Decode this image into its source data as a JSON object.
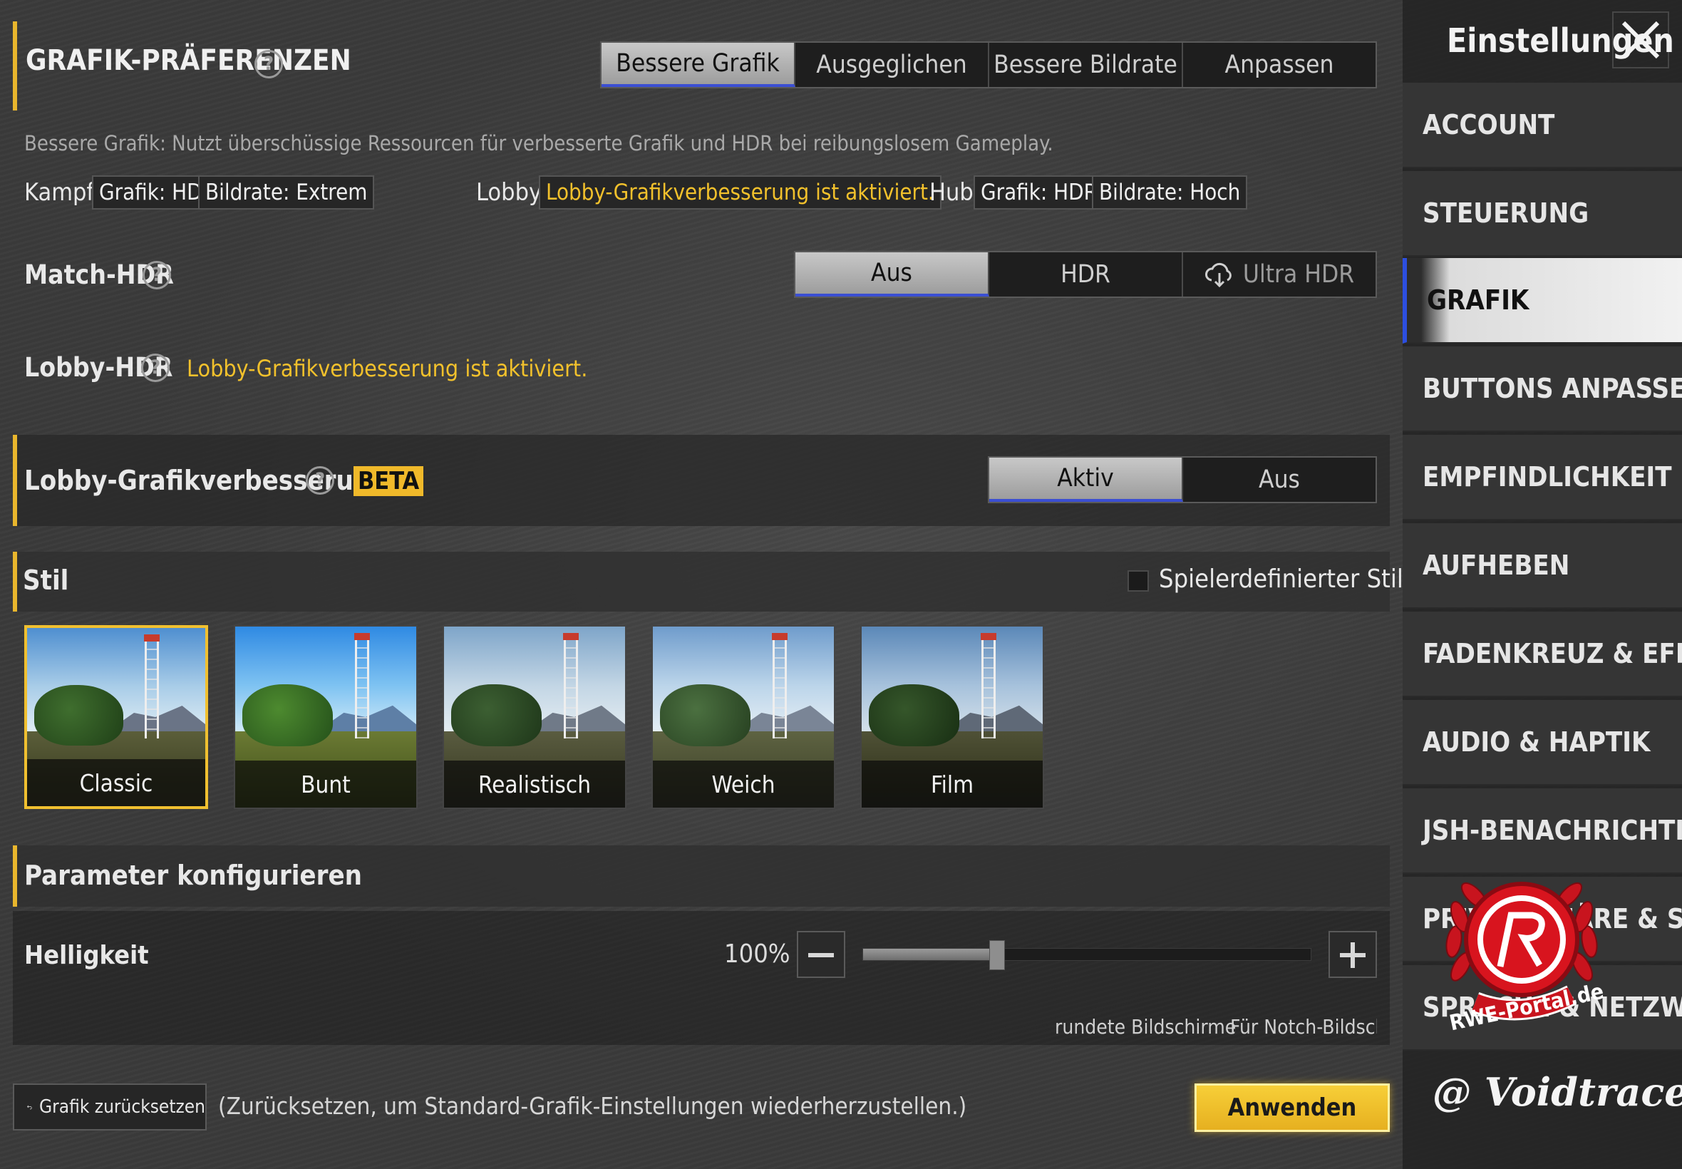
{
  "window": {
    "title": "Einstellungen"
  },
  "prefs": {
    "title": "GRAFIK-PRÄFERENZEN",
    "tabs": [
      "Bessere Grafik",
      "Ausgeglichen",
      "Bessere Bildrate",
      "Anpassen"
    ],
    "selected_tab": "Bessere Grafik",
    "description": "Bessere Grafik: Nutzt überschüssige Ressourcen für verbesserte Grafik und HDR bei reibungslosem Gameplay.",
    "kampf": {
      "label": "Kampf",
      "grafik": "Grafik: HD",
      "bildrate": "Bildrate: Extrem"
    },
    "lobby": {
      "label": "Lobby",
      "value": "Lobby-Grafikverbesserung ist aktiviert."
    },
    "hub": {
      "label": "Hub",
      "grafik": "Grafik: HDR",
      "bildrate": "Bildrate: Hoch"
    }
  },
  "match_hdr": {
    "label": "Match-HDR",
    "options": [
      "Aus",
      "HDR",
      "Ultra HDR"
    ],
    "selected": "Aus"
  },
  "lobby_hdr": {
    "label": "Lobby-HDR",
    "status": "Lobby-Grafikverbesserung ist aktiviert."
  },
  "lobby_enh": {
    "label": "Lobby-Grafikverbesserung",
    "badge": "BETA",
    "options": [
      "Aktiv",
      "Aus"
    ],
    "selected": "Aktiv"
  },
  "style": {
    "title": "Stil",
    "custom_label": "Spielerdefinierter Stil",
    "custom_checked": false,
    "cards": [
      "Classic",
      "Bunt",
      "Realistisch",
      "Weich",
      "Film"
    ],
    "selected": "Classic"
  },
  "params": {
    "title": "Parameter konfigurieren",
    "brightness_label": "Helligkeit",
    "brightness_value": "100%",
    "brightness_fraction": 0.3
  },
  "screen_opts": {
    "rounded": "rundete Bildschirme",
    "notch": "Für Notch-Bildschirn"
  },
  "footer": {
    "reset_label": "Grafik zurücksetzen",
    "reset_hint": "(Zurücksetzen, um Standard-Grafik-Einstellungen wiederherzustellen.)",
    "apply_label": "Anwenden"
  },
  "sidebar": {
    "items": [
      "ACCOUNT",
      "STEUERUNG",
      "GRAFIK",
      "BUTTONS ANPASSEN",
      "EMPFINDLICHKEIT",
      "AUFHEBEN",
      "FADENKREUZ & EFFEKTE",
      "AUDIO & HAPTIK",
      "JSH-BENACHRICHTIGUNGE",
      "PRIVATSPHÄRE & SOCIAL",
      "SPRACHE & NETZWERK"
    ],
    "selected": "GRAFIK"
  },
  "watermark": {
    "logo_text": "RWE-Portal.de",
    "credit": "@ Voidtracer"
  }
}
